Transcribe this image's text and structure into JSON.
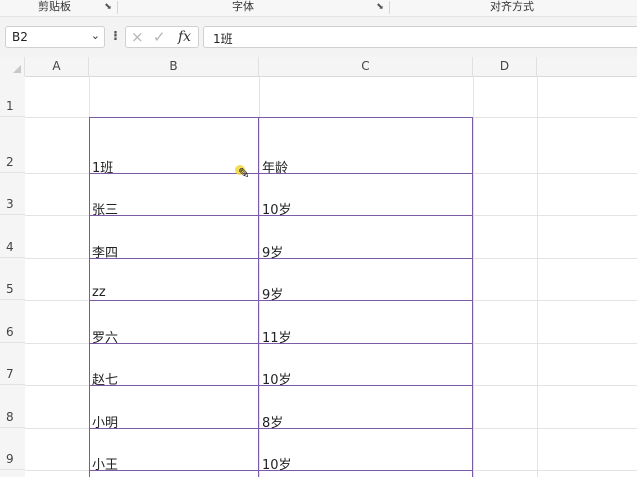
{
  "ribbon": {
    "clipboard_label": "剪贴板",
    "font_label": "字体",
    "alignment_label": "对齐方式"
  },
  "formula_bar": {
    "name_box": "B2",
    "cancel_icon": "×",
    "confirm_icon": "✓",
    "fx_label": "fx",
    "formula_value": "1班"
  },
  "columns": [
    "A",
    "B",
    "C",
    "D"
  ],
  "rows": [
    "1",
    "2",
    "3",
    "4",
    "5",
    "6",
    "7",
    "8",
    "9"
  ],
  "table": [
    {
      "b": "1班",
      "c": "年龄"
    },
    {
      "b": "张三",
      "c": "10岁"
    },
    {
      "b": "李四",
      "c": "9岁"
    },
    {
      "b": "zz",
      "c": "9岁"
    },
    {
      "b": "罗六",
      "c": "11岁"
    },
    {
      "b": "赵七",
      "c": "10岁"
    },
    {
      "b": "小明",
      "c": "8岁"
    },
    {
      "b": "小王",
      "c": "10岁"
    }
  ],
  "colors": {
    "table_border": "#7b5aa6",
    "cursor_highlight": "#f3d53a"
  }
}
